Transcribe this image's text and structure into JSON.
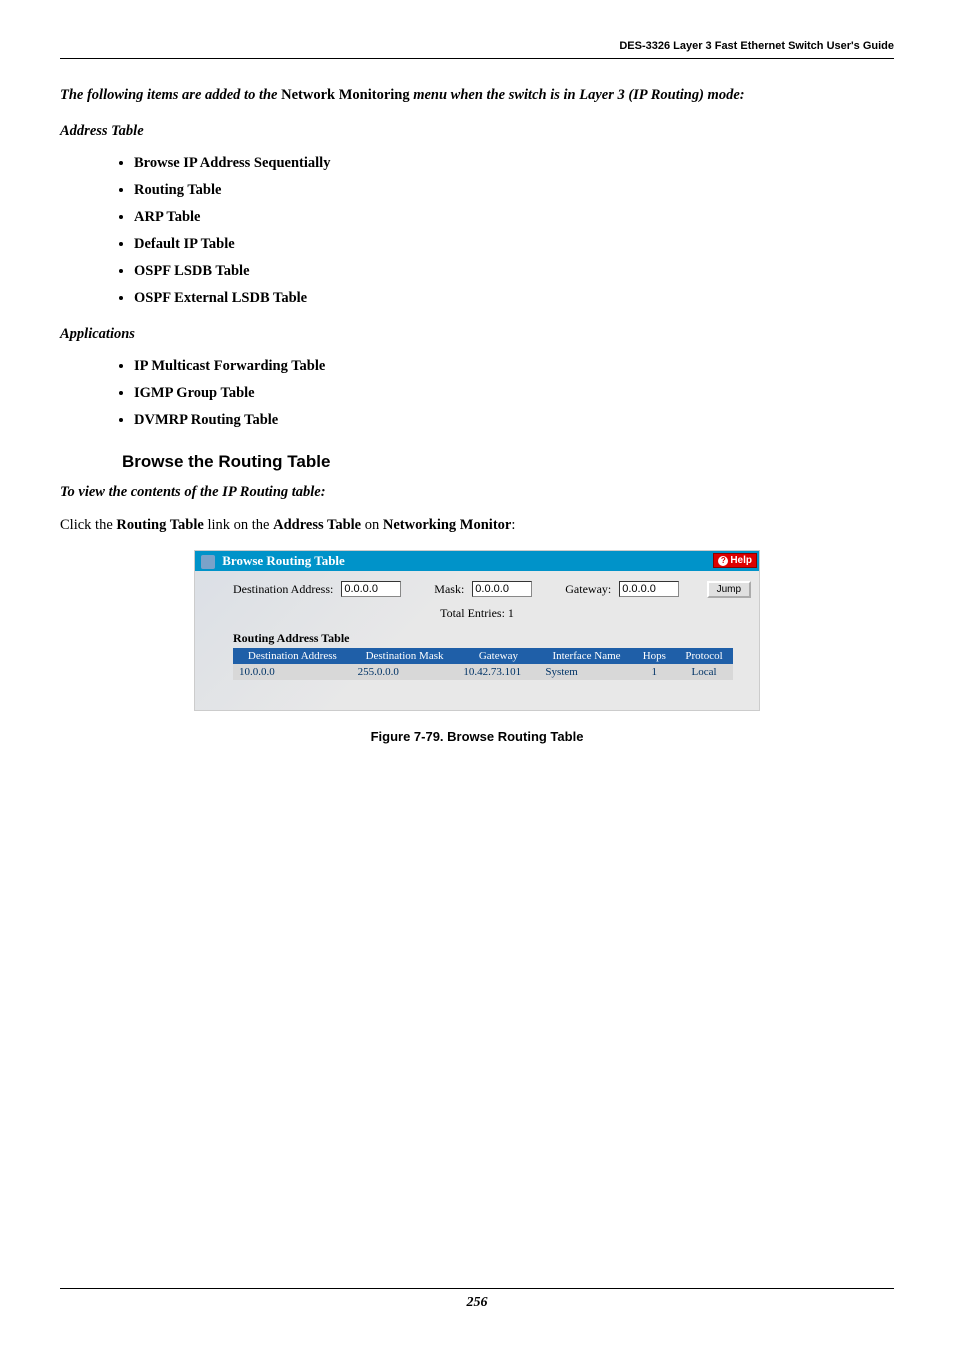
{
  "header": "DES-3326 Layer 3 Fast Ethernet Switch User's Guide",
  "intro": {
    "pre": "The following items are added to the ",
    "netmon": "Network Monitoring",
    "post": " menu when the switch is in Layer 3 (IP Routing) mode:"
  },
  "sections": {
    "addressTable": {
      "label": "Address Table",
      "items": [
        "Browse IP Address Sequentially",
        "Routing Table",
        "ARP Table",
        "Default IP Table",
        "OSPF LSDB Table",
        "OSPF External LSDB Table"
      ]
    },
    "applications": {
      "label": "Applications",
      "items": [
        "IP Multicast Forwarding Table",
        "IGMP Group Table",
        "DVMRP Routing Table"
      ]
    }
  },
  "subheading": "Browse the Routing Table",
  "toView": "To view the contents of the IP Routing table:",
  "click": {
    "pre": "Click the ",
    "b1": "Routing Table",
    "mid1": " link on the ",
    "b2": "Address Table",
    "mid2": " on ",
    "b3": "Networking Monitor",
    "post": ":"
  },
  "panel": {
    "title": "Browse Routing Table",
    "help": "Help",
    "filters": {
      "destLabel": "Destination Address:",
      "destValue": "0.0.0.0",
      "maskLabel": "Mask:",
      "maskValue": "0.0.0.0",
      "gatewayLabel": "Gateway:",
      "gatewayValue": "0.0.0.0",
      "jump": "Jump"
    },
    "totalEntries": "Total Entries: 1",
    "rat": {
      "title": "Routing Address Table",
      "headers": [
        "Destination Address",
        "Destination Mask",
        "Gateway",
        "Interface Name",
        "Hops",
        "Protocol"
      ],
      "rows": [
        [
          "10.0.0.0",
          "255.0.0.0",
          "10.42.73.101",
          "System",
          "1",
          "Local"
        ]
      ]
    }
  },
  "caption": "Figure 7-79.  Browse Routing Table",
  "pageNumber": "256"
}
